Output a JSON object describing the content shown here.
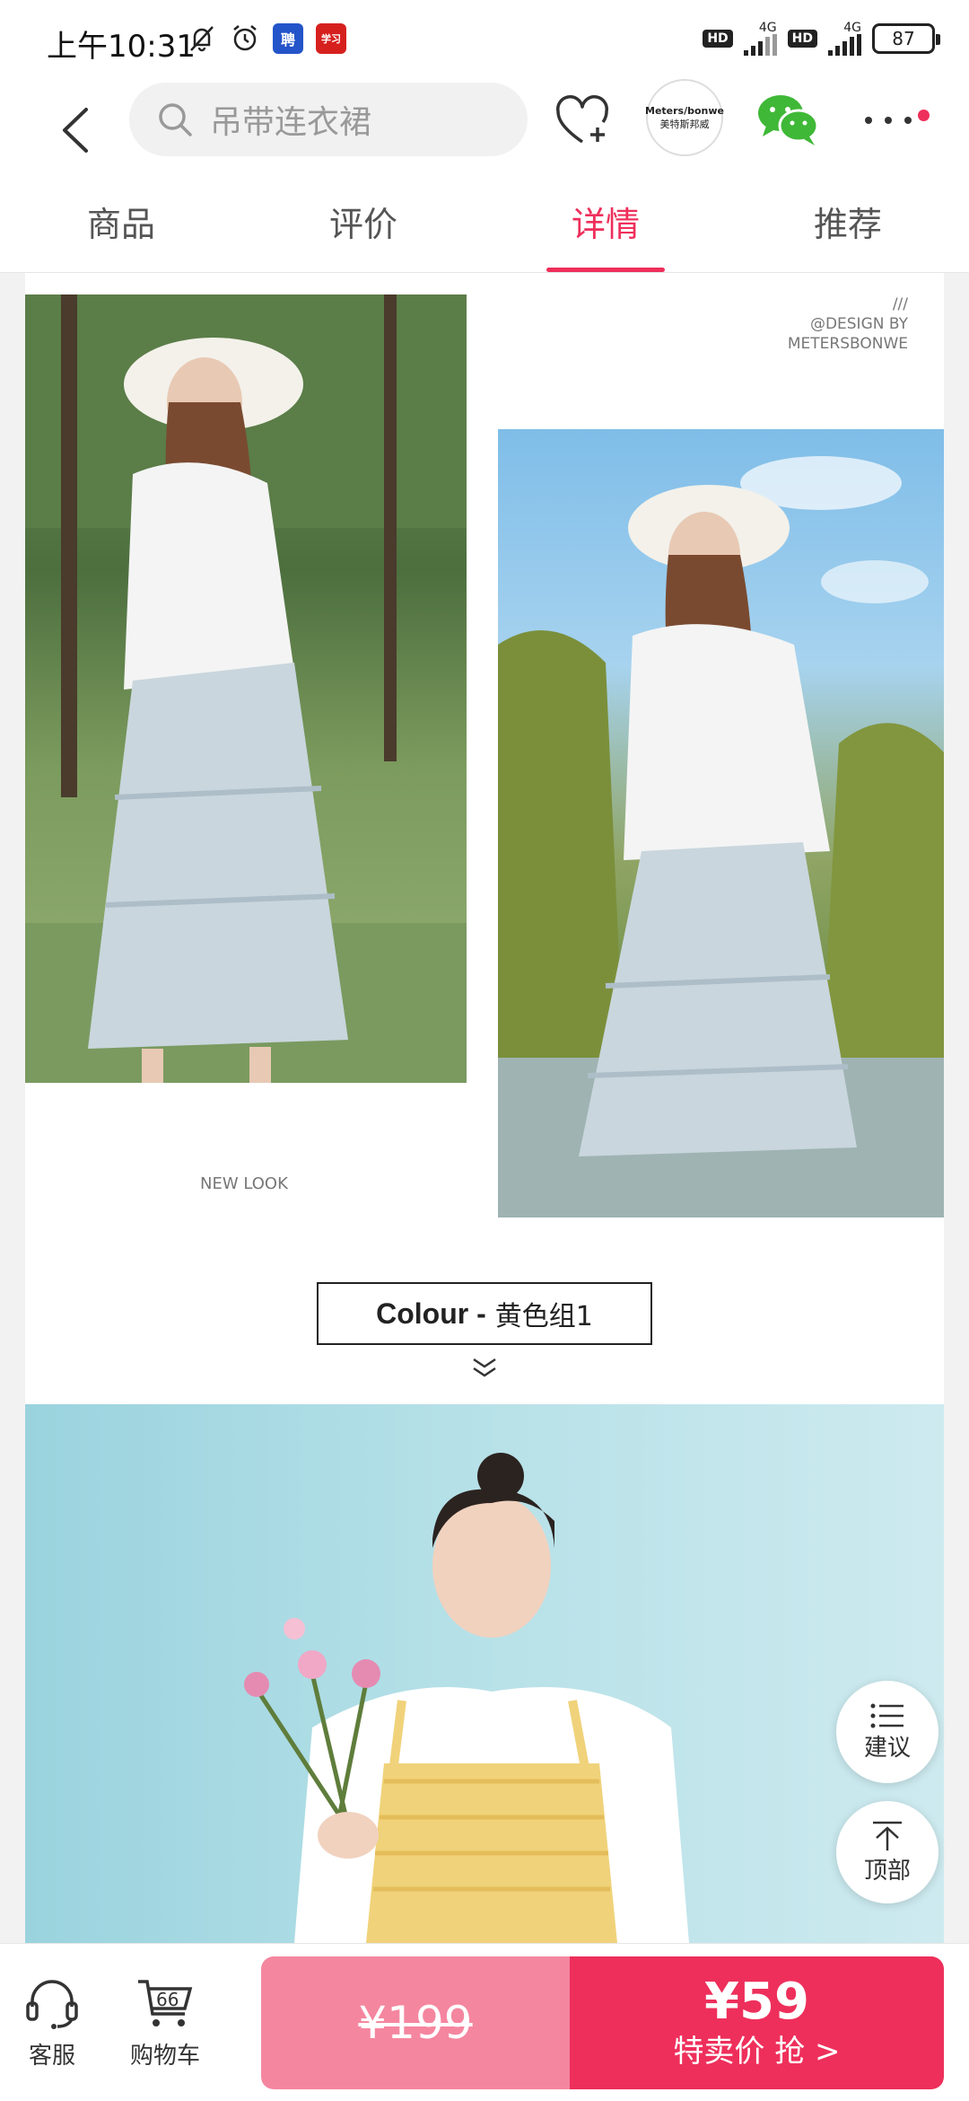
{
  "status_bar": {
    "time": "上午10:31",
    "app_badge_1": "聘",
    "app_badge_2": "学习",
    "hd": "HD",
    "net_type": "4G",
    "battery": "87"
  },
  "header": {
    "search_placeholder": "吊带连衣裙",
    "brand_line1": "Meters/bonwe",
    "brand_line2": "美特斯邦威"
  },
  "tabs": [
    {
      "label": "商品"
    },
    {
      "label": "评价"
    },
    {
      "label": "详情",
      "active": true
    },
    {
      "label": "推荐"
    }
  ],
  "content": {
    "watermark_line1": "///",
    "watermark_line2": "@DESIGN BY",
    "watermark_line3": "METERSBONWE",
    "new_look": "NEW LOOK",
    "colour_en": "Colour -",
    "colour_cn": "黄色组1"
  },
  "floating": {
    "suggest_label": "建议",
    "top_label": "顶部"
  },
  "bottom_bar": {
    "service_label": "客服",
    "cart_label": "购物车",
    "cart_count": "66",
    "original_price": "¥199",
    "sale_price": "¥59",
    "sale_label": "特卖价 抢 >"
  },
  "colors": {
    "accent": "#ee2f5b",
    "accent_light": "#f5869f"
  }
}
